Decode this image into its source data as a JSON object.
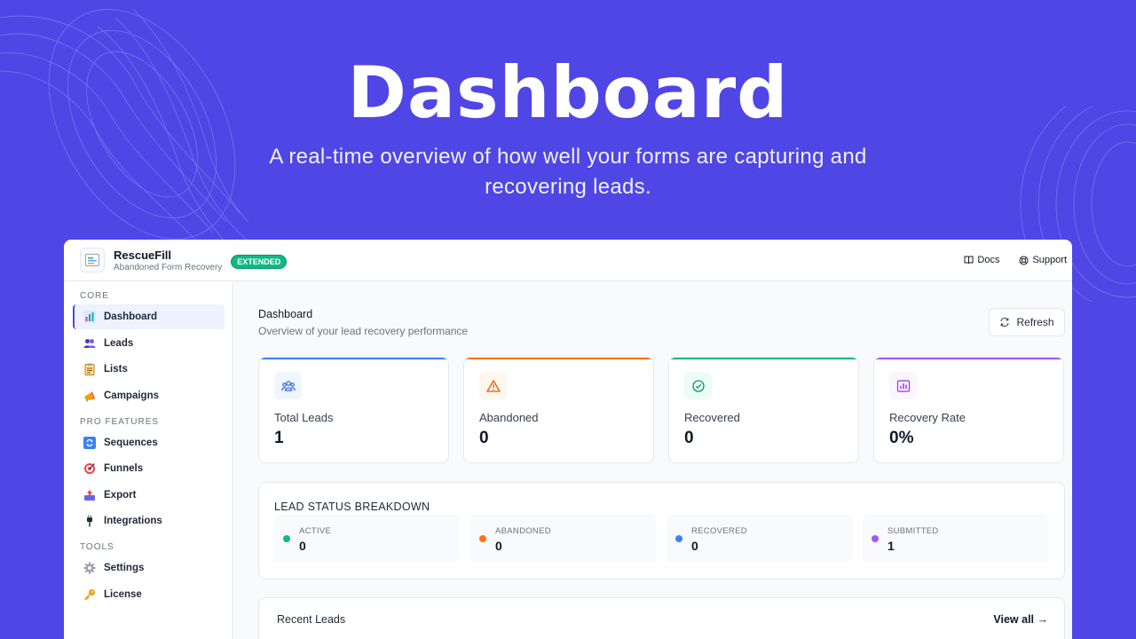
{
  "hero": {
    "title": "Dashboard",
    "subtitle": "A real-time overview of how well your forms are capturing and recovering leads."
  },
  "app": {
    "brand": {
      "name": "RescueFill",
      "tagline": "Abandoned Form Recovery",
      "badge": "EXTENDED"
    },
    "top_links": [
      {
        "label": "Docs",
        "icon": "book-icon"
      },
      {
        "label": "Support",
        "icon": "lifebuoy-icon"
      }
    ]
  },
  "sidebar": {
    "sections": [
      {
        "title": "CORE",
        "items": [
          {
            "label": "Dashboard",
            "icon": "bar-chart-icon",
            "active": true
          },
          {
            "label": "Leads",
            "icon": "users-icon"
          },
          {
            "label": "Lists",
            "icon": "clipboard-icon"
          },
          {
            "label": "Campaigns",
            "icon": "megaphone-icon"
          }
        ]
      },
      {
        "title": "PRO FEATURES",
        "items": [
          {
            "label": "Sequences",
            "icon": "sync-icon"
          },
          {
            "label": "Funnels",
            "icon": "target-icon"
          },
          {
            "label": "Export",
            "icon": "export-icon"
          },
          {
            "label": "Integrations",
            "icon": "plug-icon"
          }
        ]
      },
      {
        "title": "TOOLS",
        "items": [
          {
            "label": "Settings",
            "icon": "gear-icon"
          },
          {
            "label": "License",
            "icon": "key-icon"
          }
        ]
      }
    ]
  },
  "main": {
    "title": "Dashboard",
    "subtitle": "Overview of your lead recovery performance",
    "refresh_label": "Refresh",
    "stats": [
      {
        "label": "Total Leads",
        "value": "1",
        "color": "#3b82f6",
        "icon": "users-icon"
      },
      {
        "label": "Abandoned",
        "value": "0",
        "color": "#f97316",
        "icon": "warning-icon"
      },
      {
        "label": "Recovered",
        "value": "0",
        "color": "#10b981",
        "icon": "check-circle-icon"
      },
      {
        "label": "Recovery Rate",
        "value": "0%",
        "color": "#a855f7",
        "icon": "bar-chart-icon"
      }
    ],
    "breakdown": {
      "title": "LEAD STATUS BREAKDOWN",
      "items": [
        {
          "label": "ACTIVE",
          "value": "0",
          "color": "#10b981"
        },
        {
          "label": "ABANDONED",
          "value": "0",
          "color": "#f97316"
        },
        {
          "label": "RECOVERED",
          "value": "0",
          "color": "#3b82f6"
        },
        {
          "label": "SUBMITTED",
          "value": "1",
          "color": "#a855f7"
        }
      ]
    },
    "recent": {
      "title": "Recent Leads",
      "view_all": "View all →"
    }
  }
}
